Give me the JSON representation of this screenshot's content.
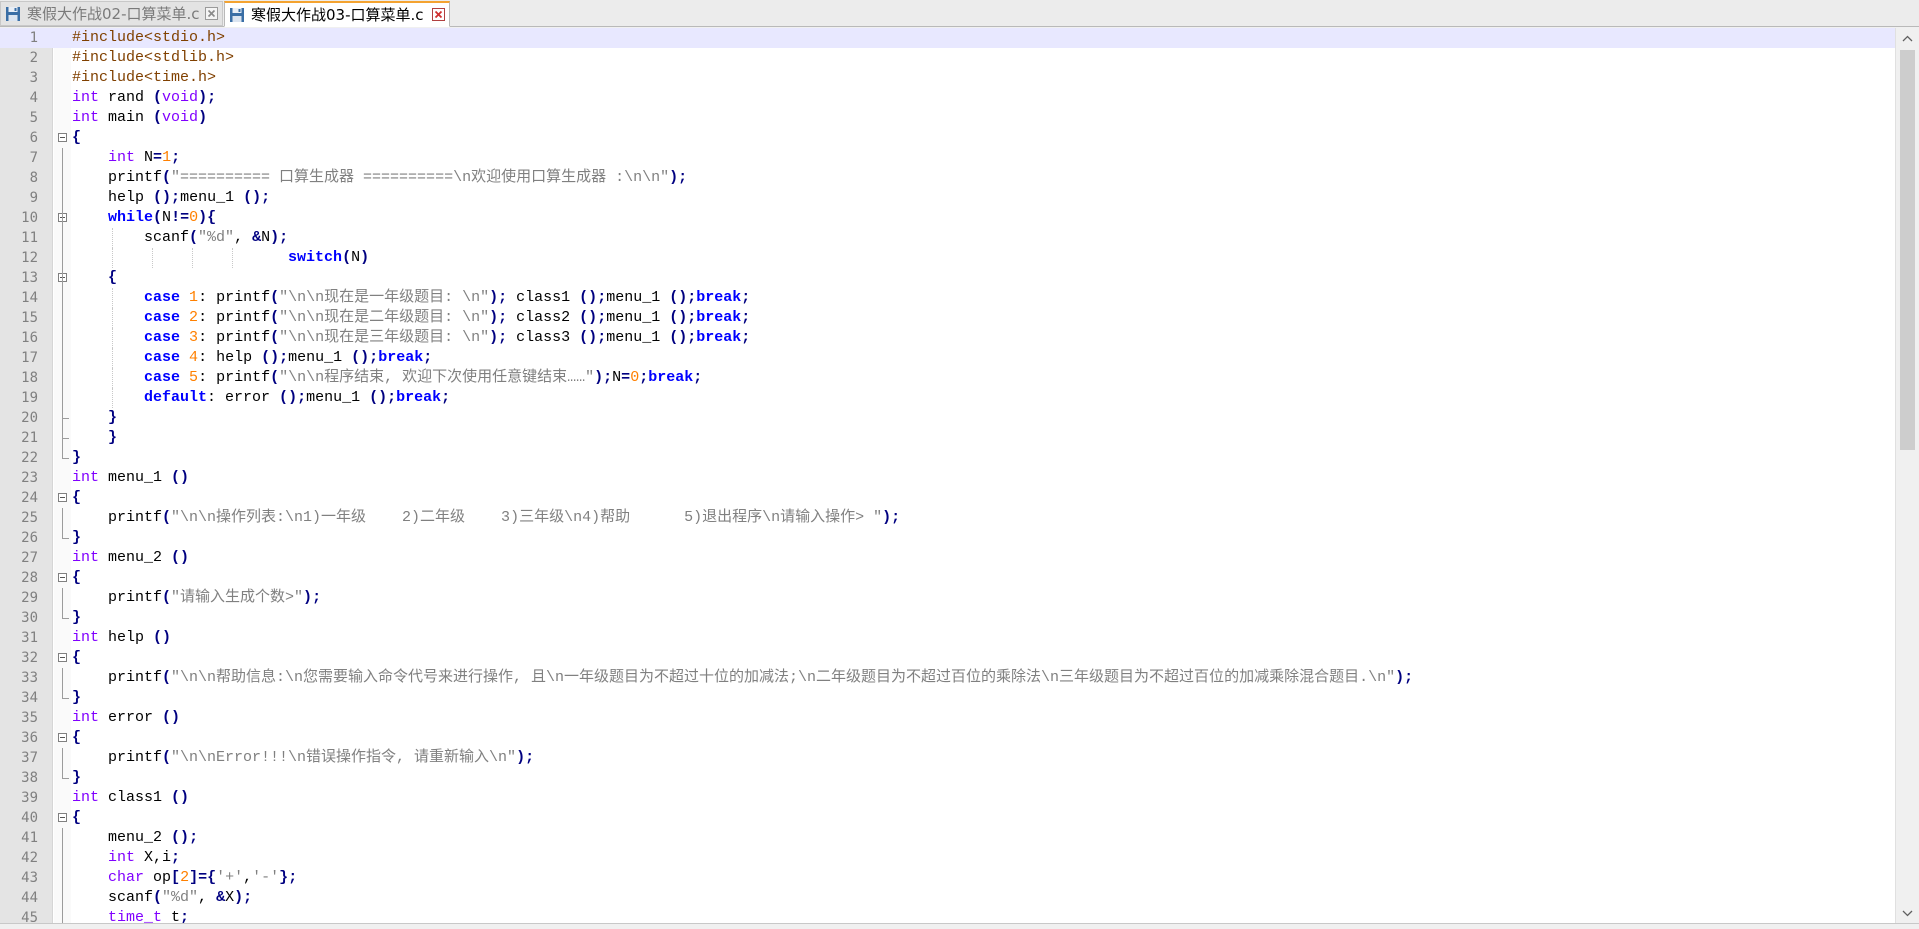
{
  "tabs": [
    {
      "label": "寒假大作战02-口算菜单.c",
      "icon": "floppy-save-icon",
      "active": false
    },
    {
      "label": "寒假大作战03-口算菜单.c",
      "icon": "floppy-save-icon",
      "active": true
    }
  ],
  "colors": {
    "keyword": "#8000ff",
    "instruction": "#0000ff",
    "string": "#808080",
    "number": "#ff8000",
    "preprocessor": "#804000",
    "operator": "#000080",
    "current_line": "#e8e8ff",
    "tab_accent": "#f4a330",
    "close_icon": "#d03030"
  },
  "lines": [
    {
      "n": "1",
      "t": "#include<stdio.h>"
    },
    {
      "n": "2",
      "t": "#include<stdlib.h>"
    },
    {
      "n": "3",
      "t": "#include<time.h>"
    },
    {
      "n": "4",
      "t": "int rand (void);"
    },
    {
      "n": "5",
      "t": "int main (void)"
    },
    {
      "n": "6",
      "t": "{"
    },
    {
      "n": "7",
      "t": "    int N=1;"
    },
    {
      "n": "8",
      "t": "    printf(\"========== 口算生成器 ==========\\n欢迎使用口算生成器 :\\n\\n\");"
    },
    {
      "n": "9",
      "t": "    help ();menu_1 ();"
    },
    {
      "n": "10",
      "t": "    while(N!=0){"
    },
    {
      "n": "11",
      "t": "        scanf(\"%d\", &N);"
    },
    {
      "n": "12",
      "t": "                        switch(N)"
    },
    {
      "n": "13",
      "t": "    {"
    },
    {
      "n": "14",
      "t": "        case 1: printf(\"\\n\\n现在是一年级题目: \\n\"); class1 ();menu_1 ();break;"
    },
    {
      "n": "15",
      "t": "        case 2: printf(\"\\n\\n现在是二年级题目: \\n\"); class2 ();menu_1 ();break;"
    },
    {
      "n": "16",
      "t": "        case 3: printf(\"\\n\\n现在是三年级题目: \\n\"); class3 ();menu_1 ();break;"
    },
    {
      "n": "17",
      "t": "        case 4: help ();menu_1 ();break;"
    },
    {
      "n": "18",
      "t": "        case 5: printf(\"\\n\\n程序结束, 欢迎下次使用任意键结束……\");N=0;break;"
    },
    {
      "n": "19",
      "t": "        default: error ();menu_1 ();break;"
    },
    {
      "n": "20",
      "t": "    }"
    },
    {
      "n": "21",
      "t": "    }"
    },
    {
      "n": "22",
      "t": "}"
    },
    {
      "n": "23",
      "t": "int menu_1 ()"
    },
    {
      "n": "24",
      "t": "{"
    },
    {
      "n": "25",
      "t": "    printf(\"\\n\\n操作列表:\\n1)一年级    2)二年级    3)三年级\\n4)帮助      5)退出程序\\n请输入操作> \");"
    },
    {
      "n": "26",
      "t": "}"
    },
    {
      "n": "27",
      "t": "int menu_2 ()"
    },
    {
      "n": "28",
      "t": "{"
    },
    {
      "n": "29",
      "t": "    printf(\"请输入生成个数>\");"
    },
    {
      "n": "30",
      "t": "}"
    },
    {
      "n": "31",
      "t": "int help ()"
    },
    {
      "n": "32",
      "t": "{"
    },
    {
      "n": "33",
      "t": "    printf(\"\\n\\n帮助信息:\\n您需要输入命令代号来进行操作, 且\\n一年级题目为不超过十位的加减法;\\n二年级题目为不超过百位的乘除法\\n三年级题目为不超过百位的加减乘除混合题目.\\n\");"
    },
    {
      "n": "34",
      "t": "}"
    },
    {
      "n": "35",
      "t": "int error ()"
    },
    {
      "n": "36",
      "t": "{"
    },
    {
      "n": "37",
      "t": "    printf(\"\\n\\nError!!!\\n错误操作指令, 请重新输入\\n\");"
    },
    {
      "n": "38",
      "t": "}"
    },
    {
      "n": "39",
      "t": "int class1 ()"
    },
    {
      "n": "40",
      "t": "{"
    },
    {
      "n": "41",
      "t": "    menu_2 ();"
    },
    {
      "n": "42",
      "t": "    int X,i;"
    },
    {
      "n": "43",
      "t": "    char op[2]={'+','-'};"
    },
    {
      "n": "44",
      "t": "    scanf(\"%d\", &X);"
    },
    {
      "n": "45",
      "t": "    time_t t;"
    }
  ],
  "folds": [
    6,
    10,
    13,
    24,
    28,
    32,
    36,
    40
  ],
  "fold_ends": [
    20,
    21,
    22,
    26,
    30,
    34,
    38
  ],
  "fold_bodies": [
    [
      7,
      21
    ],
    [
      11,
      21
    ],
    [
      14,
      19
    ],
    [
      25,
      25
    ],
    [
      29,
      29
    ],
    [
      33,
      33
    ],
    [
      37,
      37
    ],
    [
      41,
      45
    ]
  ],
  "current_line": 1,
  "scrollbar": {
    "up_icon": "scroll-up-arrow-icon",
    "down_icon": "scroll-down-arrow-icon",
    "position": 0.0
  }
}
